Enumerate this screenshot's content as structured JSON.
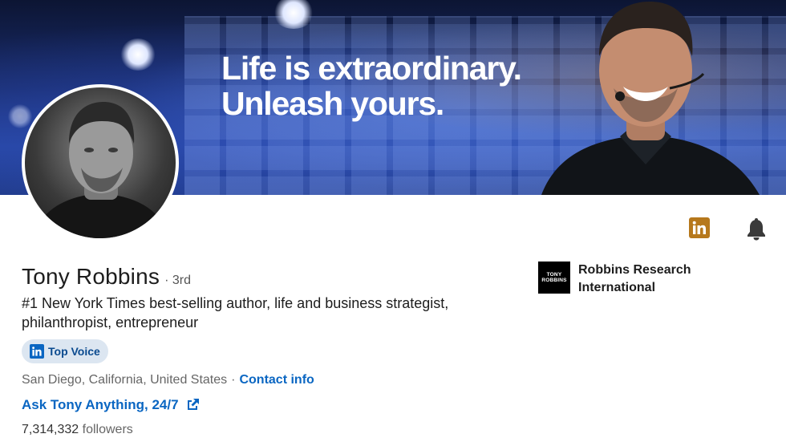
{
  "banner": {
    "line1": "Life is extraordinary.",
    "line2": "Unleash yours."
  },
  "profile": {
    "name": "Tony Robbins",
    "degree": "· 3rd",
    "headline": "#1 New York Times best-selling author, life and business strategist, philanthropist, entrepreneur",
    "badge": {
      "label": "Top Voice",
      "icon": "linkedin-icon"
    },
    "location": "San Diego, California, United States",
    "separator": "·",
    "contact_label": "Contact info",
    "website_label": "Ask Tony Anything, 24/7",
    "followers_count": "7,314,332",
    "followers_label": "followers"
  },
  "company": {
    "name": "Robbins Research International",
    "logo_line1": "TONY",
    "logo_line2": "ROBBINS"
  },
  "icons": {
    "premium": "linkedin-premium-icon",
    "bell": "bell-icon",
    "external": "external-link-icon"
  },
  "colors": {
    "link": "#0a66c2",
    "premium_gold": "#b6781c",
    "badge_bg": "#dce6f1"
  }
}
